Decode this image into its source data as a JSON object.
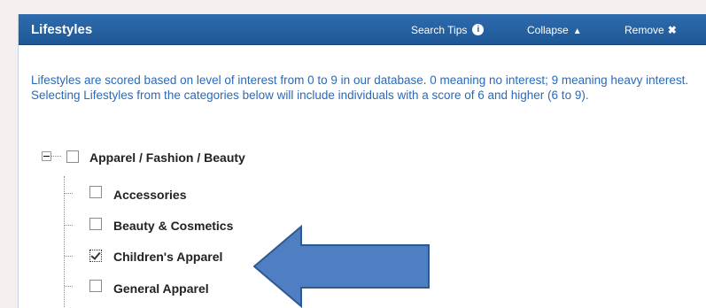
{
  "panel": {
    "title": "Lifestyles",
    "actions": {
      "search_tips": "Search Tips",
      "collapse": "Collapse",
      "remove": "Remove"
    }
  },
  "description": "Lifestyles are scored based on level of interest from 0 to 9 in our database. 0 meaning no interest; 9 meaning heavy interest. Selecting Lifestyles from the categories below will include individuals with a score of 6 and higher (6 to 9).",
  "tree": {
    "root": {
      "label": "Apparel / Fashion / Beauty",
      "checked": false,
      "expanded": true
    },
    "children": [
      {
        "label": "Accessories",
        "checked": false
      },
      {
        "label": "Beauty & Cosmetics",
        "checked": false
      },
      {
        "label": "Children's Apparel",
        "checked": true
      },
      {
        "label": "General Apparel",
        "checked": false
      }
    ]
  },
  "colors": {
    "header_bg": "#1f5795",
    "description_text": "#2a6ab8",
    "arrow_fill": "#4f7fc2",
    "arrow_stroke": "#2d5a92"
  },
  "icons": {
    "search_tips": "info-icon",
    "collapse": "sort-arrows-icon",
    "remove": "close-icon",
    "tree_toggle": "minus-box-icon"
  }
}
